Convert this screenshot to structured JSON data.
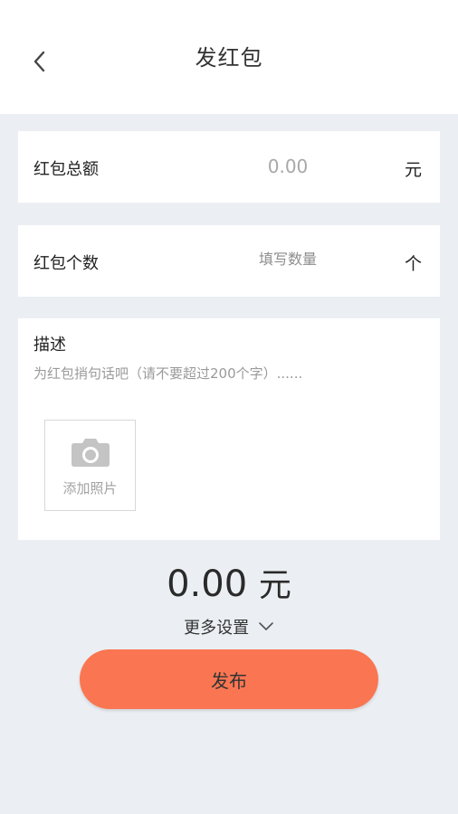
{
  "header": {
    "title": "发红包"
  },
  "amount_row": {
    "label": "红包总额",
    "placeholder": "0.00",
    "unit": "元"
  },
  "count_row": {
    "label": "红包个数",
    "placeholder": "填写数量",
    "unit": "个"
  },
  "description": {
    "title": "描述",
    "placeholder": "为红包捎句话吧（请不要超过200个字）......",
    "add_photo_label": "添加照片"
  },
  "summary": {
    "amount": "0.00",
    "currency": "元"
  },
  "more_settings": {
    "label": "更多设置"
  },
  "publish_button": {
    "label": "发布",
    "color": "#fa7652"
  },
  "icons": {
    "back": "chevron-left-icon",
    "camera": "camera-icon",
    "more": "chevron-down-icon"
  },
  "colors": {
    "background": "#ebeff3",
    "card": "#ffffff",
    "accent": "#fa7652"
  }
}
